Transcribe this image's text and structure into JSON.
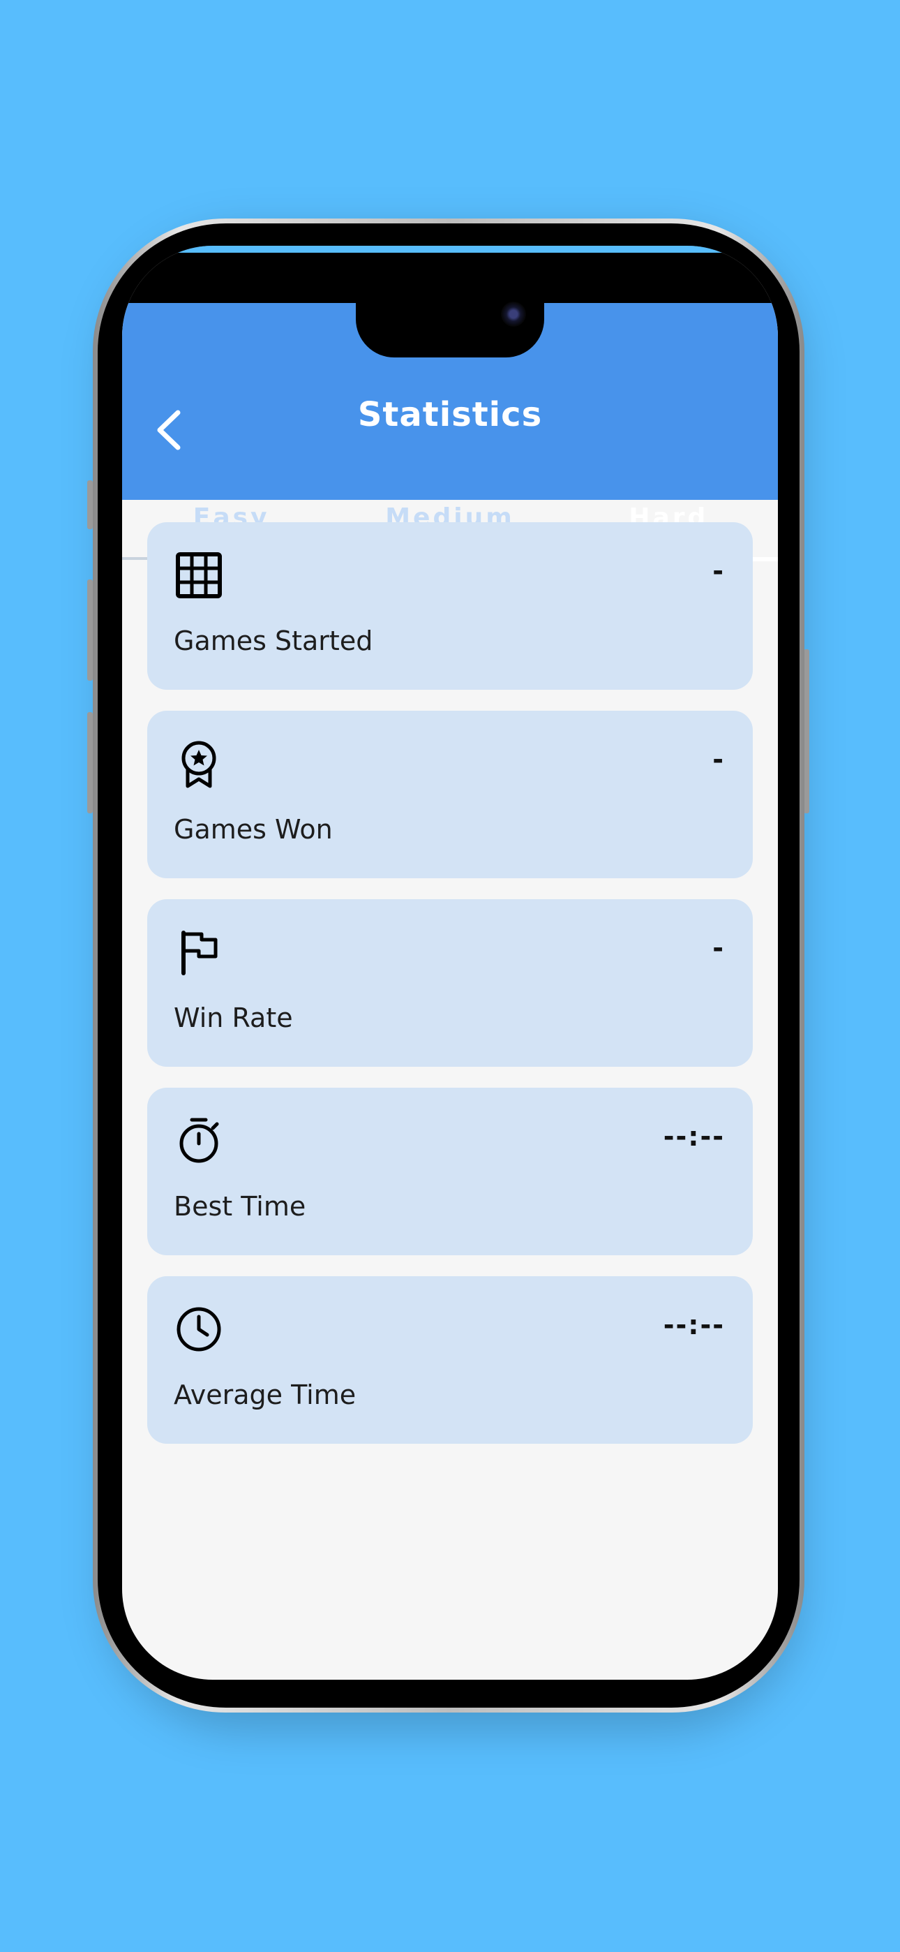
{
  "header": {
    "title": "Statistics",
    "back_icon": "chevron-left-icon"
  },
  "tabs": [
    {
      "label": "Easy",
      "active": false
    },
    {
      "label": "Medium",
      "active": false
    },
    {
      "label": "Hard",
      "active": true
    }
  ],
  "stats": [
    {
      "label": "Games Started",
      "value": "-",
      "icon": "grid-icon"
    },
    {
      "label": "Games Won",
      "value": "-",
      "icon": "award-ribbon-icon"
    },
    {
      "label": "Win Rate",
      "value": "-",
      "icon": "flag-icon"
    },
    {
      "label": "Best Time",
      "value": "--:--",
      "icon": "stopwatch-icon"
    },
    {
      "label": "Average Time",
      "value": "--:--",
      "icon": "clock-icon"
    }
  ],
  "colors": {
    "background": "#58bdfd",
    "header": "#4893eb",
    "card": "#d3e3f5",
    "screen": "#f6f6f6"
  }
}
